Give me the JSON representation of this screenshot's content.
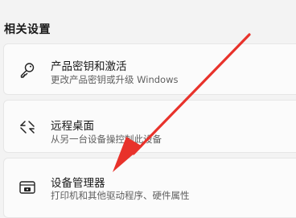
{
  "section": {
    "title": "相关设置"
  },
  "items": [
    {
      "title": "产品密钥和激活",
      "description": "更改产品密钥或升级 Windows",
      "icon": "key-icon"
    },
    {
      "title": "远程桌面",
      "description": "从另一台设备操控制此设备",
      "icon": "remote-desktop-icon"
    },
    {
      "title": "设备管理器",
      "description": "打印机和其他驱动程序、硬件属性",
      "icon": "device-manager-icon"
    }
  ],
  "annotation": {
    "color": "#e8322b",
    "icon": "red-arrow"
  }
}
